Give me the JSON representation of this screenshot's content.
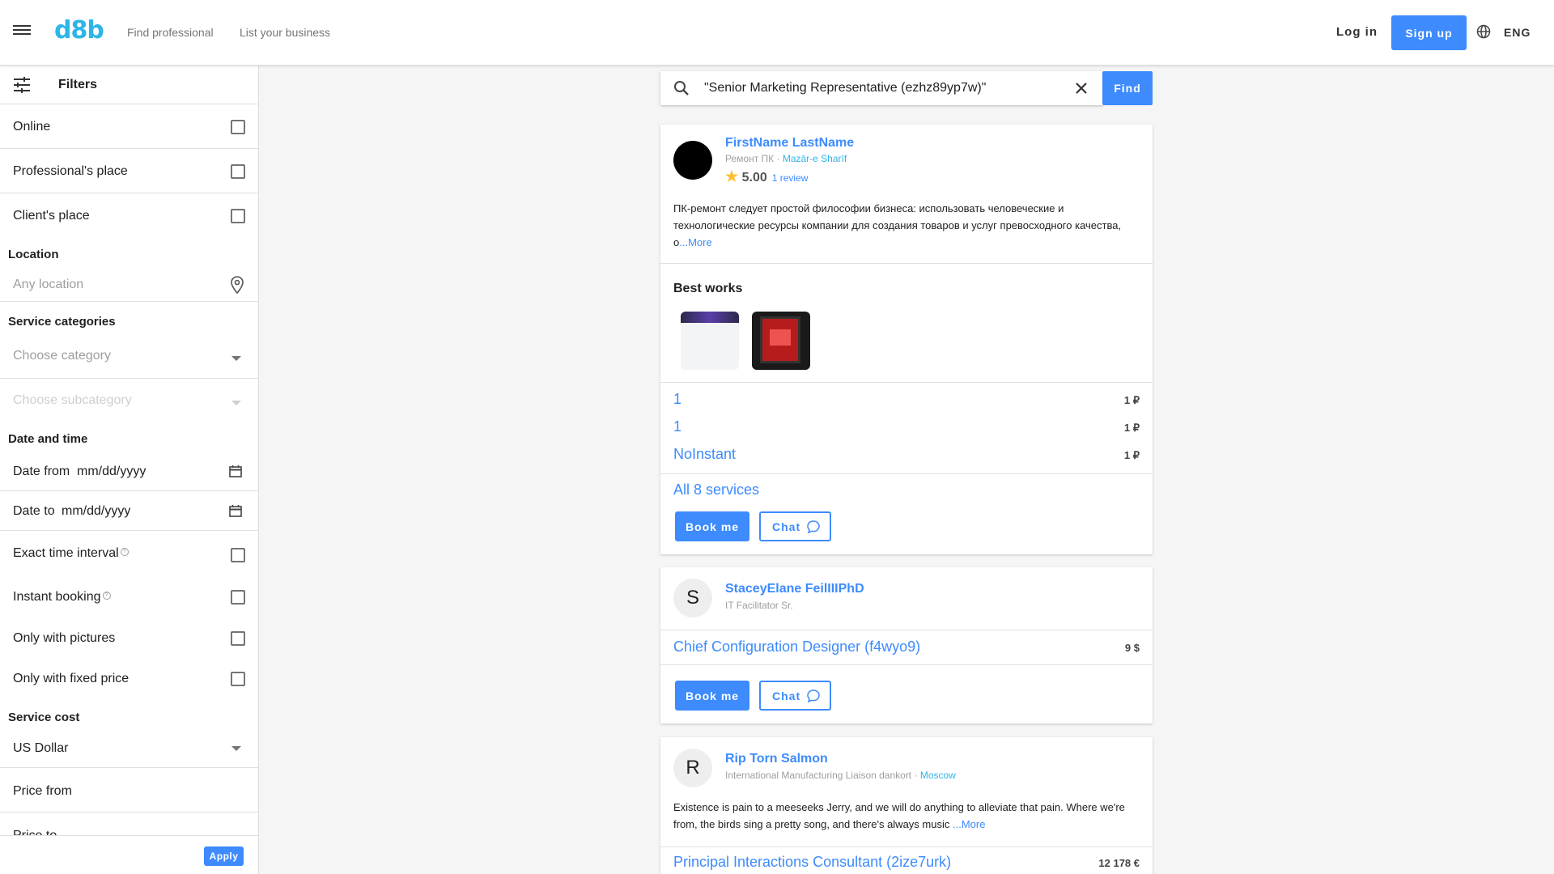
{
  "header": {
    "logo": "d8b",
    "nav": [
      "Find professional",
      "List your business"
    ],
    "login": "Log in",
    "signup": "Sign up",
    "language": "ENG"
  },
  "filters": {
    "title": "Filters",
    "place_options": [
      "Online",
      "Professional's place",
      "Client's place"
    ],
    "location_label": "Location",
    "location_placeholder": "Any location",
    "categories_label": "Service categories",
    "category_placeholder": "Choose category",
    "subcategory_placeholder": "Choose subcategory",
    "datetime_label": "Date and time",
    "date_from_label": "Date from",
    "date_to_label": "Date to",
    "date_placeholder": "mm/dd/yyyy",
    "exact_time_label": "Exact time interval",
    "instant_booking_label": "Instant booking",
    "only_pictures_label": "Only with pictures",
    "only_fixed_price_label": "Only with fixed price",
    "service_cost_label": "Service cost",
    "currency": "US Dollar",
    "price_from": "Price from",
    "price_to": "Price to",
    "apply": "Apply"
  },
  "search": {
    "value": "\"Senior Marketing Representative (ezhz89yp7w)\"",
    "find": "Find"
  },
  "results": [
    {
      "name": "FirstName LastName",
      "subtitle": "Ремонт ПК",
      "separator": " · ",
      "city": "Mazār-e Sharīf",
      "rating": "5.00",
      "reviews": "1 review",
      "description": "ПК-ремонт следует простой философии бизнеса: использовать человеческие и технологические ресурсы компании для создания товаров и услуг превосходного качества, о",
      "more": "...More",
      "best_works": "Best works",
      "services": [
        {
          "name": "1",
          "price": "1 ₽"
        },
        {
          "name": "1",
          "price": "1 ₽"
        },
        {
          "name": "NoInstant",
          "price": "1 ₽"
        }
      ],
      "all_services": "All 8 services",
      "book": "Book me",
      "chat": "Chat"
    },
    {
      "name": "StaceyElane FeilIIIPhD",
      "avatar_letter": "S",
      "subtitle": "IT Facilitator Sr.",
      "services": [
        {
          "name": "Chief Configuration Designer (f4wyo9)",
          "price": "9 $"
        }
      ],
      "book": "Book me",
      "chat": "Chat"
    },
    {
      "name": "Rip Torn Salmon",
      "avatar_letter": "R",
      "subtitle": "International Manufacturing Liaison dankort",
      "separator": " · ",
      "city": "Moscow",
      "description": "Existence is pain to a meeseeks Jerry, and we will do anything to alleviate that pain. Where we're from, the birds sing a pretty song, and there's always music ",
      "more": "...More",
      "services": [
        {
          "name": "Principal Interactions Consultant (2ize7urk)",
          "price": "12 178 €"
        }
      ]
    }
  ],
  "colors": {
    "accent": "#3d8bfd",
    "logo": "#2db5e8",
    "star": "#fbc02d"
  }
}
